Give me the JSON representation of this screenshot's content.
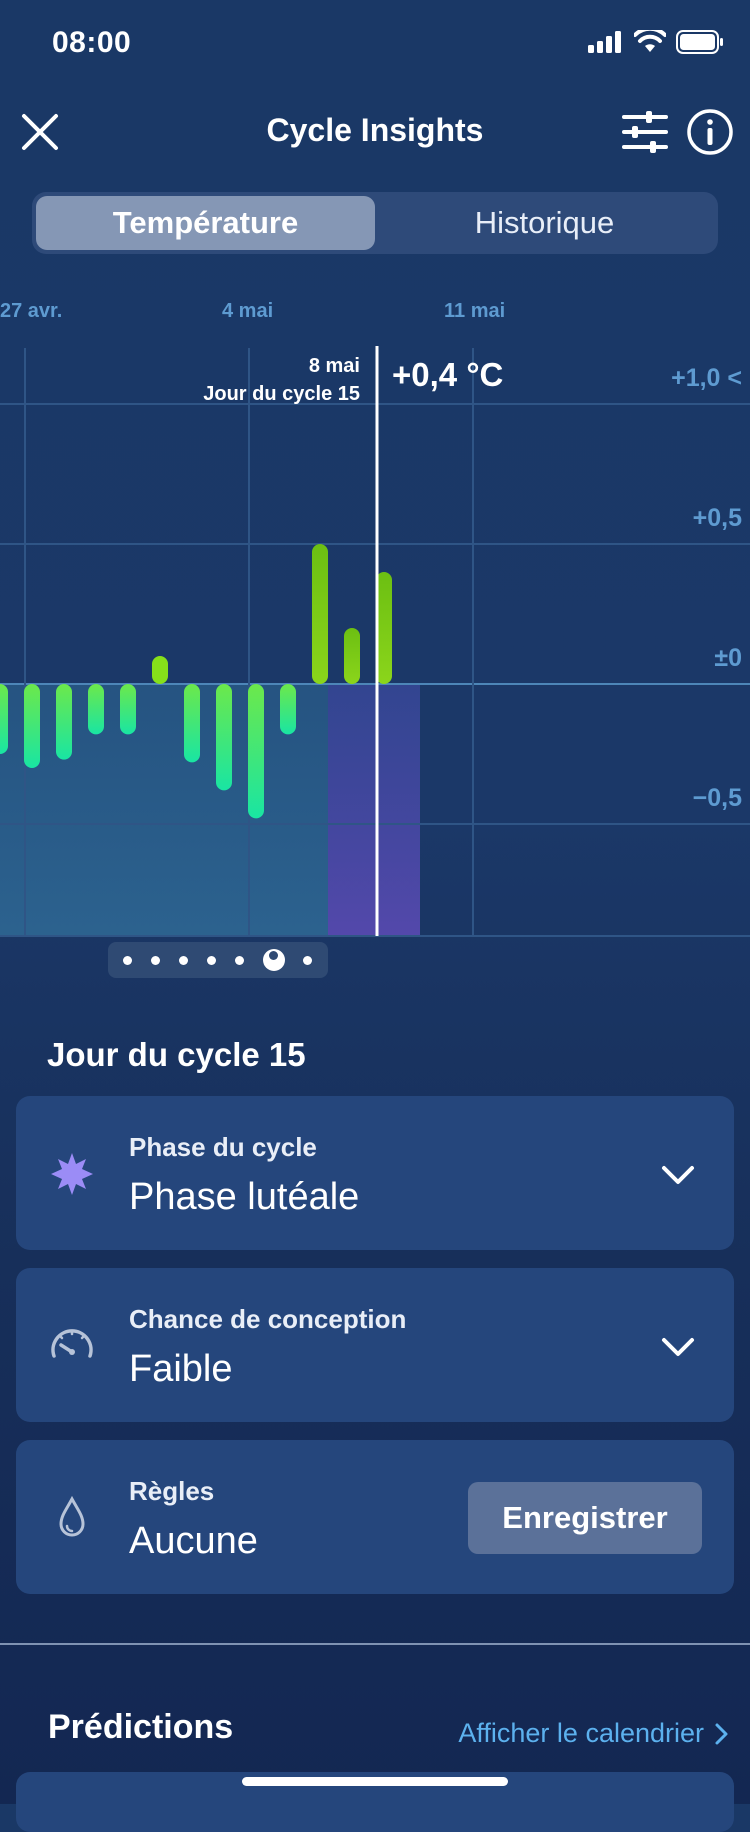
{
  "status_bar": {
    "time": "08:00"
  },
  "header": {
    "title": "Cycle Insights",
    "close_icon": "close-icon",
    "filter_icon": "sliders-icon",
    "info_icon": "info-icon"
  },
  "tabs": [
    {
      "label": "Température",
      "active": true
    },
    {
      "label": "Historique",
      "active": false
    }
  ],
  "chart": {
    "date_labels": [
      "27 avr.",
      "4 mai",
      "11 mai"
    ],
    "y_labels": [
      "+1,0 <",
      "+0,5",
      "±0",
      "−0,5"
    ],
    "tooltip": {
      "date": "8 mai",
      "cycle_day": "Jour du cycle 15",
      "value": "+0,4 °C"
    },
    "page_count": 7,
    "active_page": 6
  },
  "chart_data": {
    "type": "bar",
    "x": [
      "25 avr.",
      "26 avr.",
      "27 avr.",
      "28 avr.",
      "29 avr.",
      "30 avr.",
      "1 mai",
      "2 mai",
      "3 mai",
      "4 mai",
      "5 mai",
      "6 mai",
      "7 mai",
      "8 mai"
    ],
    "values": [
      -0.25,
      -0.3,
      -0.27,
      -0.18,
      -0.18,
      0.1,
      -0.28,
      -0.38,
      -0.48,
      -0.18,
      0.5,
      0.2,
      0.4,
      null
    ],
    "ylabel": "",
    "ylim": [
      -0.9,
      1.2
    ],
    "y_ticks": [
      "+1,0 <",
      "+0,5",
      "±0",
      "−0,5"
    ],
    "x_ticks": [
      "27 avr.",
      "4 mai",
      "11 mai"
    ],
    "highlighted_x": "8 mai"
  },
  "day_section": {
    "title": "Jour du cycle 15"
  },
  "cards": {
    "phase": {
      "label": "Phase du cycle",
      "value": "Phase lutéale"
    },
    "conception": {
      "label": "Chance de conception",
      "value": "Faible"
    },
    "regles": {
      "label": "Règles",
      "value": "Aucune",
      "button": "Enregistrer"
    }
  },
  "predictions": {
    "title": "Prédictions",
    "link": "Afficher le calendrier"
  },
  "colors": {
    "accent_link": "#5cb1ee",
    "bar_low": "#22e08f",
    "bar_high": "#8ad400",
    "luteal_highlight": "#5f4fb3"
  }
}
